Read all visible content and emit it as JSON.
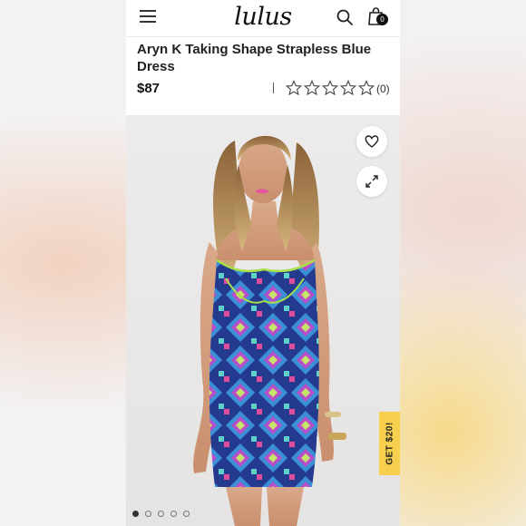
{
  "header": {
    "logo": "lulus",
    "bag_count": "0"
  },
  "product": {
    "title": "Aryn K Taking Shape Strapless Blue Dress",
    "price": "$87",
    "rating_stars": 5,
    "rating_filled": 0,
    "review_count": "(0)"
  },
  "image": {
    "total_images": 5,
    "active_index": 0
  },
  "promo": {
    "label": "GET $20!"
  },
  "icons": {
    "menu": "hamburger-menu-icon",
    "search": "search-icon",
    "bag": "shopping-bag-icon",
    "favorite": "heart-icon",
    "expand": "expand-icon",
    "star": "star-outline-icon"
  },
  "colors": {
    "promo_bg": "#f5cf4d",
    "text": "#222222"
  }
}
